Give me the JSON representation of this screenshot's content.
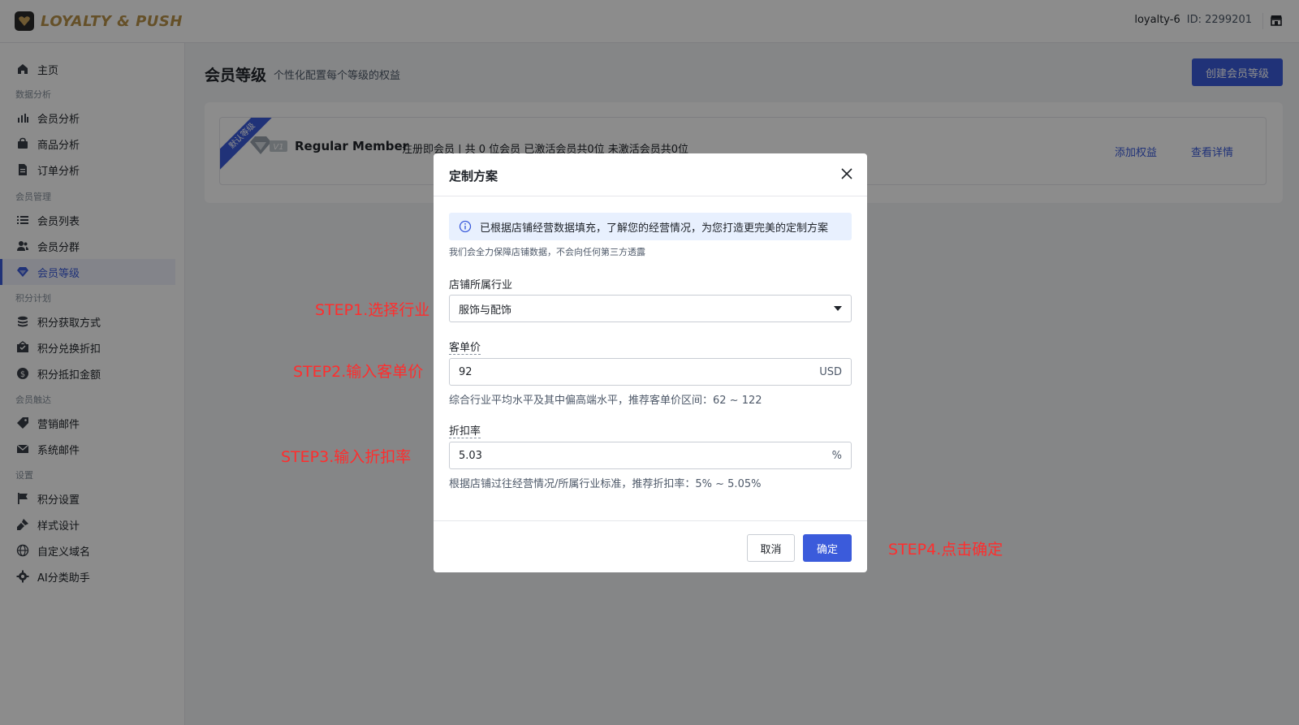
{
  "app": {
    "logo_text": "LOYALTY & PUSH",
    "account_name": "loyalty-6",
    "account_id": "ID: 2299201"
  },
  "sidebar": {
    "items": [
      {
        "label": "主页",
        "icon": "home-icon"
      },
      {
        "group": "数据分析"
      },
      {
        "label": "会员分析",
        "icon": "bar-chart-icon"
      },
      {
        "label": "商品分析",
        "icon": "bag-icon"
      },
      {
        "label": "订单分析",
        "icon": "document-icon"
      },
      {
        "group": "会员管理"
      },
      {
        "label": "会员列表",
        "icon": "list-icon"
      },
      {
        "label": "会员分群",
        "icon": "users-icon"
      },
      {
        "label": "会员等级",
        "icon": "diamond-icon",
        "active": true
      },
      {
        "group": "积分计划"
      },
      {
        "label": "积分获取方式",
        "icon": "stack-icon"
      },
      {
        "label": "积分兑换折扣",
        "icon": "ticket-icon"
      },
      {
        "label": "积分抵扣金额",
        "icon": "dollar-icon"
      },
      {
        "group": "会员触达"
      },
      {
        "label": "营销邮件",
        "icon": "tag-icon"
      },
      {
        "label": "系统邮件",
        "icon": "mail-icon"
      },
      {
        "group": "设置"
      },
      {
        "label": "积分设置",
        "icon": "flag-icon"
      },
      {
        "label": "样式设计",
        "icon": "brush-icon"
      },
      {
        "label": "自定义域名",
        "icon": "globe-icon"
      },
      {
        "label": "AI分类助手",
        "icon": "gear-icon"
      }
    ]
  },
  "main": {
    "title": "会员等级",
    "subtitle": "个性化配置每个等级的权益",
    "create_button": "创建会员等级",
    "tier": {
      "ribbon": "默认等级",
      "badge": "V1",
      "name": "Regular Member",
      "info": "注册即会员 | 共 0 位会员 已激活会员共0位 未激活会员共0位",
      "add_benefit": "添加权益",
      "view_details": "查看详情"
    }
  },
  "modal": {
    "title": "定制方案",
    "notice": "已根据店铺经营数据填充，了解您的经营情况，为您打造更完美的定制方案",
    "notice_sub": "我们会全力保障店铺数据，不会向任何第三方透露",
    "industry": {
      "label": "店铺所属行业",
      "value": "服饰与配饰"
    },
    "aov": {
      "label": "客单价",
      "value": "92",
      "suffix": "USD",
      "hint": "综合行业平均水平及其中偏高端水平，推荐客单价区间：62 ~ 122"
    },
    "discount": {
      "label": "折扣率",
      "value": "5.03",
      "suffix": "%",
      "hint": "根据店铺过往经营情况/所属行业标准，推荐折扣率：5% ~ 5.05%"
    },
    "cancel": "取消",
    "confirm": "确定"
  },
  "annotations": {
    "step1": "STEP1.选择行业",
    "step2": "STEP2.输入客单价",
    "step3": "STEP3.输入折扣率",
    "step4": "STEP4.点击确定"
  },
  "colors": {
    "accent": "#3b5bdb",
    "logo_gold": "#b8924a",
    "annotation_red": "#ff2d2d"
  }
}
